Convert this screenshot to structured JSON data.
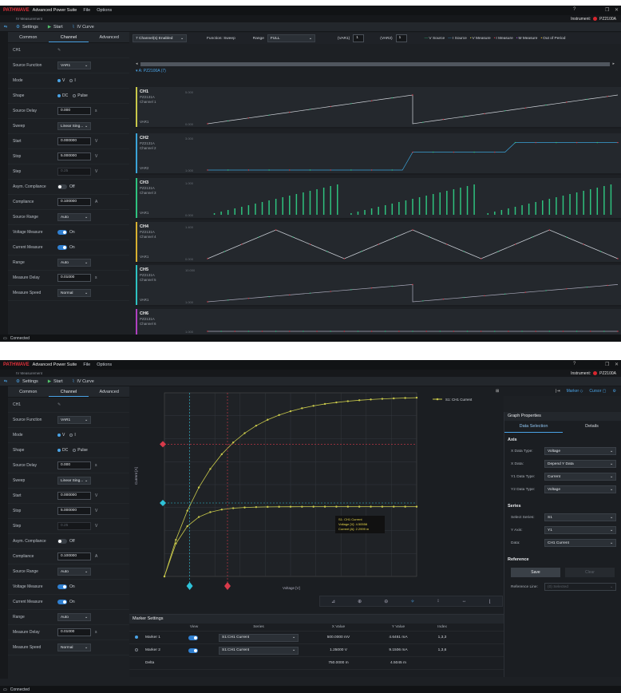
{
  "app": {
    "logo": "PATHWAVE",
    "title": "Advanced Power Suite",
    "file": "File",
    "options": "Options",
    "sub": "IV Measurement",
    "instrument_label": "Instrument:",
    "instrument": "PZ2100A",
    "status": "Connected"
  },
  "toolbar": {
    "settings": "Settings",
    "start": "Start",
    "ivcurve": "IV Curve"
  },
  "tabs": [
    "Common",
    "Channel",
    "Advanced"
  ],
  "channel_name": "CH1",
  "params": [
    {
      "label": "Source Function",
      "type": "select",
      "value": "VAR1"
    },
    {
      "label": "Mode",
      "type": "radio",
      "opts": [
        "V",
        "I"
      ],
      "sel": 0
    },
    {
      "label": "Shape",
      "type": "radio",
      "opts": [
        "DC",
        "Pulse"
      ],
      "sel": 0
    },
    {
      "label": "Source Delay",
      "type": "input",
      "value": "0.000",
      "unit": "s"
    },
    {
      "label": "Sweep",
      "type": "select",
      "value": "Linear Sing..."
    },
    {
      "label": "Start",
      "type": "input",
      "value": "0.000000",
      "unit": "V"
    },
    {
      "label": "Stop",
      "type": "input",
      "value": "5.000000",
      "unit": "V"
    },
    {
      "label": "Step",
      "type": "input",
      "value": "0.25",
      "unit": "V",
      "dis": true
    },
    {
      "label": "Asym. Compliance",
      "type": "toggle",
      "on": false,
      "text": "Off"
    },
    {
      "label": "Compliance",
      "type": "input",
      "value": "0.100000",
      "unit": "A"
    },
    {
      "label": "Source Range",
      "type": "select",
      "value": "Auto"
    },
    {
      "label": "Voltage Measure",
      "type": "toggle",
      "on": true,
      "text": "On"
    },
    {
      "label": "Current Measure",
      "type": "toggle",
      "on": true,
      "text": "On"
    },
    {
      "label": "Range",
      "type": "select",
      "value": "Auto"
    },
    {
      "label": "Measure Delay",
      "type": "input",
      "value": "0.01000",
      "unit": "s"
    },
    {
      "label": "Measure Speed",
      "type": "select",
      "value": "Normal"
    }
  ],
  "top": {
    "enabled": "7 Channel(s) Enabled",
    "function_label": "Function: Sweep",
    "range_label": "Range",
    "range": "FULL",
    "var1_label": "(VAR1)",
    "var1": "1",
    "var2_label": "(VAR2)",
    "var2": "1",
    "legend": [
      "V Source",
      "I Source",
      "V Measure",
      "I Measure",
      "M Measure",
      "Out of Period"
    ],
    "group": "A: PZ2100A (7)",
    "channels": [
      {
        "name": "CH1",
        "model": "PZ2131A",
        "sub": "Channel 1",
        "var": "VAR1",
        "color": "#c8c84a",
        "ytop": "5.000",
        "ybot": "0.000"
      },
      {
        "name": "CH2",
        "model": "PZ2131A",
        "sub": "Channel 2",
        "var": "VAR2",
        "color": "#3aa3d8",
        "ytop": "3.000",
        "ybot": "1.000"
      },
      {
        "name": "CH3",
        "model": "PZ2131A",
        "sub": "Channel 3",
        "var": "VAR1",
        "color": "#2ec27e",
        "ytop": "1.000",
        "ybot": "0.000"
      },
      {
        "name": "CH4",
        "model": "PZ2131A",
        "sub": "Channel 4",
        "var": "VAR1",
        "color": "#d8b030",
        "ytop": "1.400",
        "ybot": "0.000"
      },
      {
        "name": "CH5",
        "model": "PZ2131A",
        "sub": "Channel 5",
        "var": "VAR1",
        "color": "#2ec2c2",
        "ytop": "10.000",
        "ybot": "1.000"
      },
      {
        "name": "CH6",
        "model": "PZ2131A",
        "sub": "Channel 6",
        "var": "",
        "color": "#b040c0",
        "ytop": "",
        "ybot": "1.000"
      }
    ]
  },
  "graph": {
    "series_label": "S1: CH1 Current",
    "ylabel": "Current [A]",
    "xlabel": "Voltage [V]",
    "tooltip": [
      "S1: CH1 Current",
      "Voltage [V]: 4.50558",
      "Current [A]: 2.2999 m"
    ],
    "markers_tb": [
      "Marker",
      "Cursor"
    ]
  },
  "props": {
    "header": "Graph Properties",
    "tabs": [
      "Data Selection",
      "Details"
    ],
    "axis_h": "Axis",
    "axis": [
      [
        "X Data Type:",
        "Voltage"
      ],
      [
        "X Data:",
        "Depend Y Data"
      ],
      [
        "Y1 Data Type:",
        "Current"
      ],
      [
        "Y2 Data Type:",
        "Voltage"
      ]
    ],
    "series_h": "Series",
    "series": [
      [
        "Select Series:",
        "S1"
      ],
      [
        "Y Axis:",
        "Y1"
      ],
      [
        "Data:",
        "CH1 Current"
      ]
    ],
    "ref_h": "Reference",
    "save": "Save",
    "clear": "Clear",
    "refline": "Reference Line:",
    "refval": "(0) Selected"
  },
  "markers": {
    "header": "Marker Settings",
    "cols": [
      "View",
      "Series",
      "X Value",
      "Y Value",
      "Index"
    ],
    "rows": [
      {
        "name": "Marker 1",
        "series": "S1:CH1 Current",
        "x": "500.0000 mV",
        "y": "4.6461 mA",
        "idx": "1,3,3"
      },
      {
        "name": "Marker 2",
        "series": "S1:CH1 Current",
        "x": "1.25000 V",
        "y": "9.1506 mA",
        "idx": "1,3,6"
      }
    ],
    "delta": {
      "name": "Delta",
      "x": "750.0000 m",
      "y": "4.5045 m"
    }
  }
}
